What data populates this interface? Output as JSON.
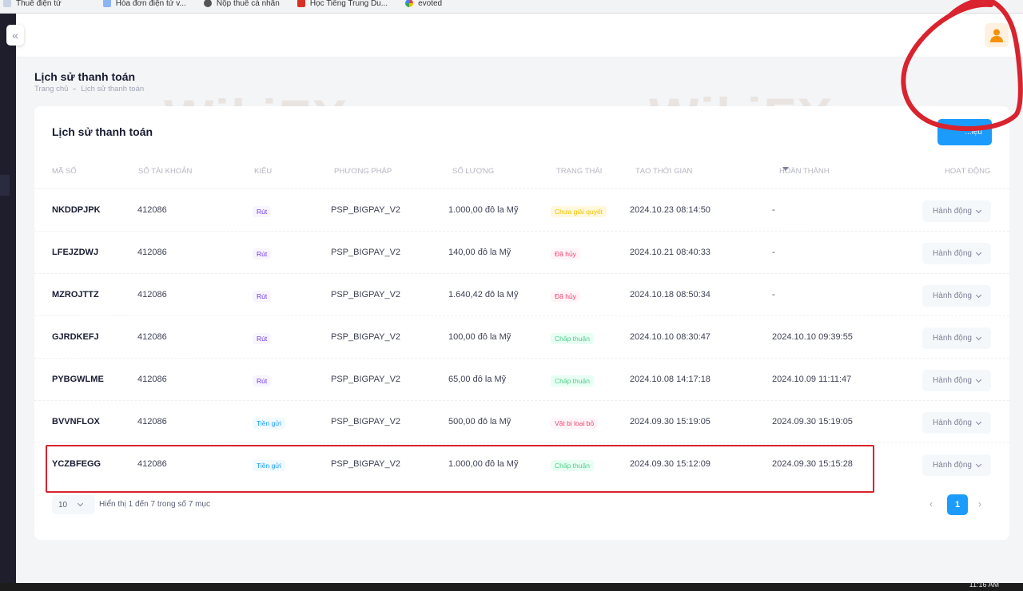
{
  "bookmarks": [
    {
      "label": "Thuế điện tử",
      "icon": "bookmark-icon"
    },
    {
      "label": "Hóa đơn điện tử v...",
      "icon": "document-icon"
    },
    {
      "label": "Nộp thuế cá nhân",
      "icon": "globe-icon"
    },
    {
      "label": "Học Tiếng Trung Du...",
      "icon": "flag-icon"
    },
    {
      "label": "evoted",
      "icon": "google-icon"
    }
  ],
  "page": {
    "title": "Lịch sử thanh toán",
    "breadcrumb": [
      "Trang chủ",
      "Lịch sử thanh toán"
    ]
  },
  "card": {
    "title": "Lịch sử thanh toán",
    "top_button_label": "...iệu"
  },
  "table": {
    "headers": [
      "Mã số",
      "Số tài khoản",
      "Kiểu",
      "Phương pháp",
      "Số lượng",
      "Trạng thái",
      "Tạo thời gian",
      "Hoàn thành",
      "Hoạt động"
    ],
    "action_label": "Hành động",
    "rows": [
      {
        "code": "NKDDPJPK",
        "account": "412086",
        "type": "Rút",
        "method": "PSP_BIGPAY_V2",
        "amount": "1.000,00 đô la Mỹ",
        "status": "Chưa giải quyết",
        "created": "2024.10.23 08:14:50",
        "completed": "-"
      },
      {
        "code": "LFEJZDWJ",
        "account": "412086",
        "type": "Rút",
        "method": "PSP_BIGPAY_V2",
        "amount": "140,00 đô la Mỹ",
        "status": "Đã hủy",
        "created": "2024.10.21 08:40:33",
        "completed": "-"
      },
      {
        "code": "MZROJTTZ",
        "account": "412086",
        "type": "Rút",
        "method": "PSP_BIGPAY_V2",
        "amount": "1.640,42 đô la Mỹ",
        "status": "Đã hủy",
        "created": "2024.10.18 08:50:34",
        "completed": "-"
      },
      {
        "code": "GJRDKEFJ",
        "account": "412086",
        "type": "Rút",
        "method": "PSP_BIGPAY_V2",
        "amount": "100,00 đô la Mỹ",
        "status": "Chấp thuận",
        "created": "2024.10.10 08:30:47",
        "completed": "2024.10.10 09:39:55"
      },
      {
        "code": "PYBGWLME",
        "account": "412086",
        "type": "Rút",
        "method": "PSP_BIGPAY_V2",
        "amount": "65,00 đô la Mỹ",
        "status": "Chấp thuận",
        "created": "2024.10.08 14:17:18",
        "completed": "2024.10.09 11:11:47"
      },
      {
        "code": "BVVNFLOX",
        "account": "412086",
        "type": "Tiền gửi",
        "method": "PSP_BIGPAY_V2",
        "amount": "500,00 đô la Mỹ",
        "status": "Vật bị loại bỏ",
        "created": "2024.09.30 15:19:05",
        "completed": "2024.09.30 15:19:05"
      },
      {
        "code": "YCZBFEGG",
        "account": "412086",
        "type": "Tiền gửi",
        "method": "PSP_BIGPAY_V2",
        "amount": "1.000,00 đô la Mỹ",
        "status": "Chấp thuận",
        "created": "2024.09.30 15:12:09",
        "completed": "2024.09.30 15:15:28"
      }
    ]
  },
  "pagination": {
    "page_size": "10",
    "info": "Hiển thị 1 đến 7 trong số 7 mục",
    "current_page": "1",
    "prev": "‹",
    "next": "›"
  },
  "watermark": "WikiFX",
  "taskbar": {
    "clock": "11:16 AM"
  },
  "colors": {
    "primary": "#1b9cfc",
    "pending": "#f6c000",
    "cancelled": "#f1416c",
    "approved": "#50cd89",
    "withdraw": "#7239ea",
    "deposit": "#1b9cfc",
    "annotation_red": "#d9232e"
  }
}
